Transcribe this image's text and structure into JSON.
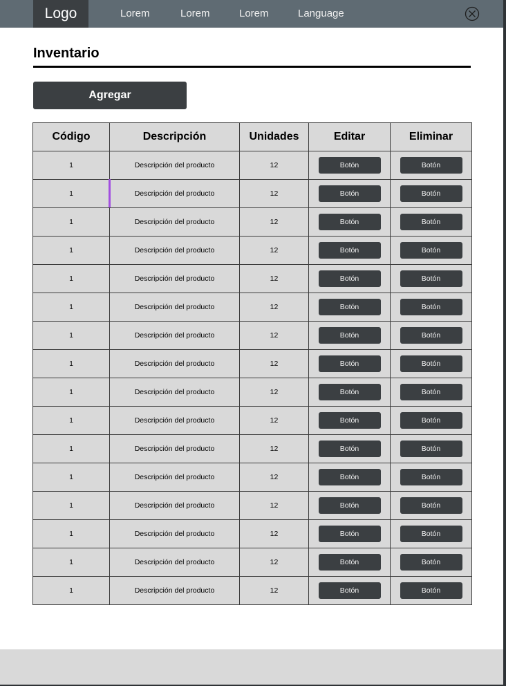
{
  "navbar": {
    "logo": "Logo",
    "links": [
      "Lorem",
      "Lorem",
      "Lorem",
      "Language"
    ],
    "close_icon": "close-circle-icon"
  },
  "page": {
    "title": "Inventario",
    "add_label": "Agregar"
  },
  "table": {
    "columns": [
      "Código",
      "Descripción",
      "Unidades",
      "Editar",
      "Eliminar"
    ],
    "button_label": "Botón",
    "rows": [
      {
        "code": "1",
        "description": "Descripción del producto",
        "units": "12"
      },
      {
        "code": "1",
        "description": "Descripción del producto",
        "units": "12"
      },
      {
        "code": "1",
        "description": "Descripción del producto",
        "units": "12"
      },
      {
        "code": "1",
        "description": "Descripción del producto",
        "units": "12"
      },
      {
        "code": "1",
        "description": "Descripción del producto",
        "units": "12"
      },
      {
        "code": "1",
        "description": "Descripción del producto",
        "units": "12"
      },
      {
        "code": "1",
        "description": "Descripción del producto",
        "units": "12"
      },
      {
        "code": "1",
        "description": "Descripción del producto",
        "units": "12"
      },
      {
        "code": "1",
        "description": "Descripción del producto",
        "units": "12"
      },
      {
        "code": "1",
        "description": "Descripción del producto",
        "units": "12"
      },
      {
        "code": "1",
        "description": "Descripción del producto",
        "units": "12"
      },
      {
        "code": "1",
        "description": "Descripción del producto",
        "units": "12"
      },
      {
        "code": "1",
        "description": "Descripción del producto",
        "units": "12"
      },
      {
        "code": "1",
        "description": "Descripción del producto",
        "units": "12"
      },
      {
        "code": "1",
        "description": "Descripción del producto",
        "units": "12"
      },
      {
        "code": "1",
        "description": "Descripción del producto",
        "units": "12"
      }
    ]
  },
  "colors": {
    "navbar": "#5f6b73",
    "dark_button": "#3b3f42",
    "table_bg": "#d9d9d9",
    "highlight": "#a24ee0"
  }
}
